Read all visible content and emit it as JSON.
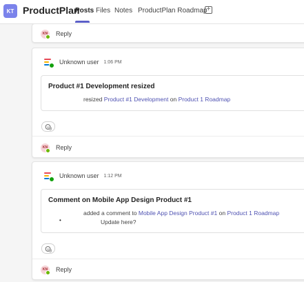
{
  "header": {
    "team_initials": "KT",
    "app_title": "ProductPlan",
    "tabs": [
      {
        "label": "Posts",
        "active": true
      },
      {
        "label": "Files",
        "active": false
      },
      {
        "label": "Notes",
        "active": false
      },
      {
        "label": "ProductPlan Roadmap",
        "active": false
      }
    ],
    "add_tab_icon": "plus-square-icon",
    "accent_color": "#5b5fc7"
  },
  "thread0": {
    "reply_avatar_initials": "KN",
    "reply_label": "Reply"
  },
  "posts": [
    {
      "user_name": "Unknown user",
      "timestamp": "1:06 PM",
      "card_title": "Product #1 Development resized",
      "body_action": "resized",
      "body_link1": "Product #1 Development",
      "body_on": "on",
      "body_link2": "Product 1 Roadmap",
      "reaction_icon": "add-reaction-icon",
      "reply_avatar_initials": "KN",
      "reply_label": "Reply"
    },
    {
      "user_name": "Unknown user",
      "timestamp": "1:12 PM",
      "card_title": "Comment on Mobile App Design Product #1",
      "body_action": "added a comment to",
      "body_link1": "Mobile App Design Product #1",
      "body_on": "on",
      "body_link2": "Product 1 Roadmap",
      "bullet_text": "Update here?",
      "reaction_icon": "add-reaction-icon",
      "reply_avatar_initials": "KN",
      "reply_label": "Reply"
    }
  ]
}
